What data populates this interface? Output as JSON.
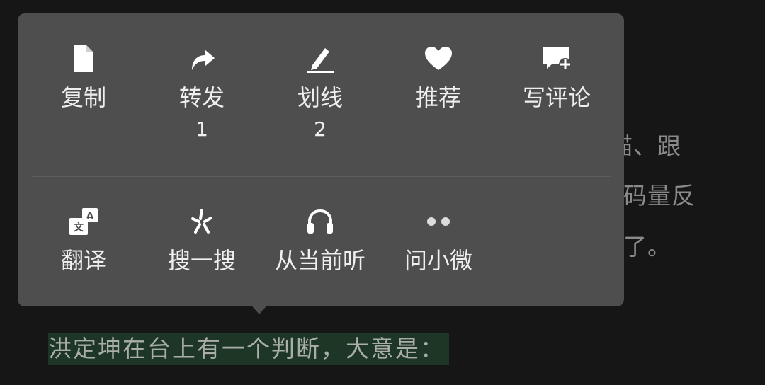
{
  "background_text": {
    "line1": "描、跟",
    "line2": "码量反",
    "line3": "了。"
  },
  "highlighted_text": "洪定坤在台上有一个判断，大意是：",
  "menu": {
    "row1": [
      {
        "label": "复制",
        "count": "",
        "icon": "document-icon"
      },
      {
        "label": "转发",
        "count": "1",
        "icon": "forward-arrow-icon"
      },
      {
        "label": "划线",
        "count": "2",
        "icon": "pen-underline-icon"
      },
      {
        "label": "推荐",
        "count": "",
        "icon": "heart-icon"
      },
      {
        "label": "写评论",
        "count": "",
        "icon": "comment-add-icon"
      }
    ],
    "row2": [
      {
        "label": "翻译",
        "icon": "translate-icon"
      },
      {
        "label": "搜一搜",
        "icon": "search-spark-icon"
      },
      {
        "label": "从当前听",
        "icon": "headphones-icon"
      },
      {
        "label": "问小微",
        "icon": "two-dots-icon"
      }
    ]
  },
  "colors": {
    "background": "#161616",
    "menu": "#4e4e4e",
    "highlight": "#1e3626"
  }
}
